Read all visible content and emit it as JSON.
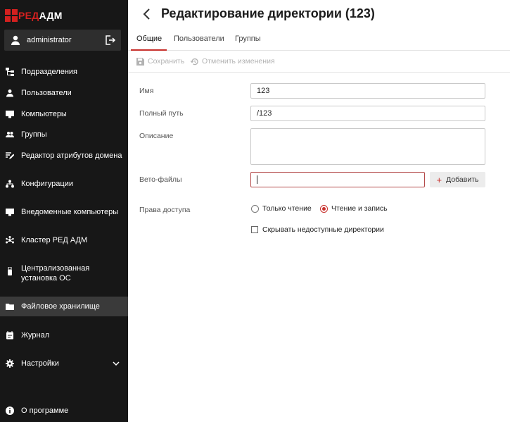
{
  "brand": {
    "part1": "РЕД",
    "part2": "АДМ"
  },
  "user": {
    "name": "administrator"
  },
  "nav": [
    {
      "label": "Подразделения",
      "icon": "org-structure-icon"
    },
    {
      "label": "Пользователи",
      "icon": "user-icon"
    },
    {
      "label": "Компьютеры",
      "icon": "monitor-icon"
    },
    {
      "label": "Группы",
      "icon": "group-icon"
    },
    {
      "label": "Редактор атрибутов домена",
      "icon": "edit-attributes-icon"
    },
    {
      "label": "Конфигурации",
      "icon": "configuration-icon"
    },
    {
      "label": "Внедоменные компьютеры",
      "icon": "monitor-icon"
    },
    {
      "label": "Кластер РЕД АДМ",
      "icon": "cluster-icon"
    },
    {
      "label": "Централизованная установка ОС",
      "icon": "usb-install-icon"
    },
    {
      "label": "Файловое хранилище",
      "icon": "folder-icon",
      "active": true
    },
    {
      "label": "Журнал",
      "icon": "journal-icon"
    },
    {
      "label": "Настройки",
      "icon": "gear-icon"
    },
    {
      "label": "О программе",
      "icon": "info-icon"
    }
  ],
  "header": {
    "title": "Редактирование директории (123)"
  },
  "tabs": [
    {
      "label": "Общие",
      "active": true
    },
    {
      "label": "Пользователи"
    },
    {
      "label": "Группы"
    }
  ],
  "toolbar": {
    "save": "Сохранить",
    "cancel": "Отменить изменения"
  },
  "form": {
    "name_label": "Имя",
    "name_value": "123",
    "path_label": "Полный путь",
    "path_value": "/123",
    "description_label": "Описание",
    "description_value": "",
    "veto_label": "Вето-файлы",
    "veto_value": "",
    "add_label": "Добавить",
    "access_label": "Права доступа",
    "access_options": [
      "Только чтение",
      "Чтение и запись"
    ],
    "access_selected": "Чтение и запись",
    "hide_label": "Скрывать недоступные директории",
    "hide_checked": false
  },
  "colors": {
    "accent": "#c8302c",
    "sidebar_bg": "#171717",
    "sidebar_active": "#3a3a3a"
  }
}
